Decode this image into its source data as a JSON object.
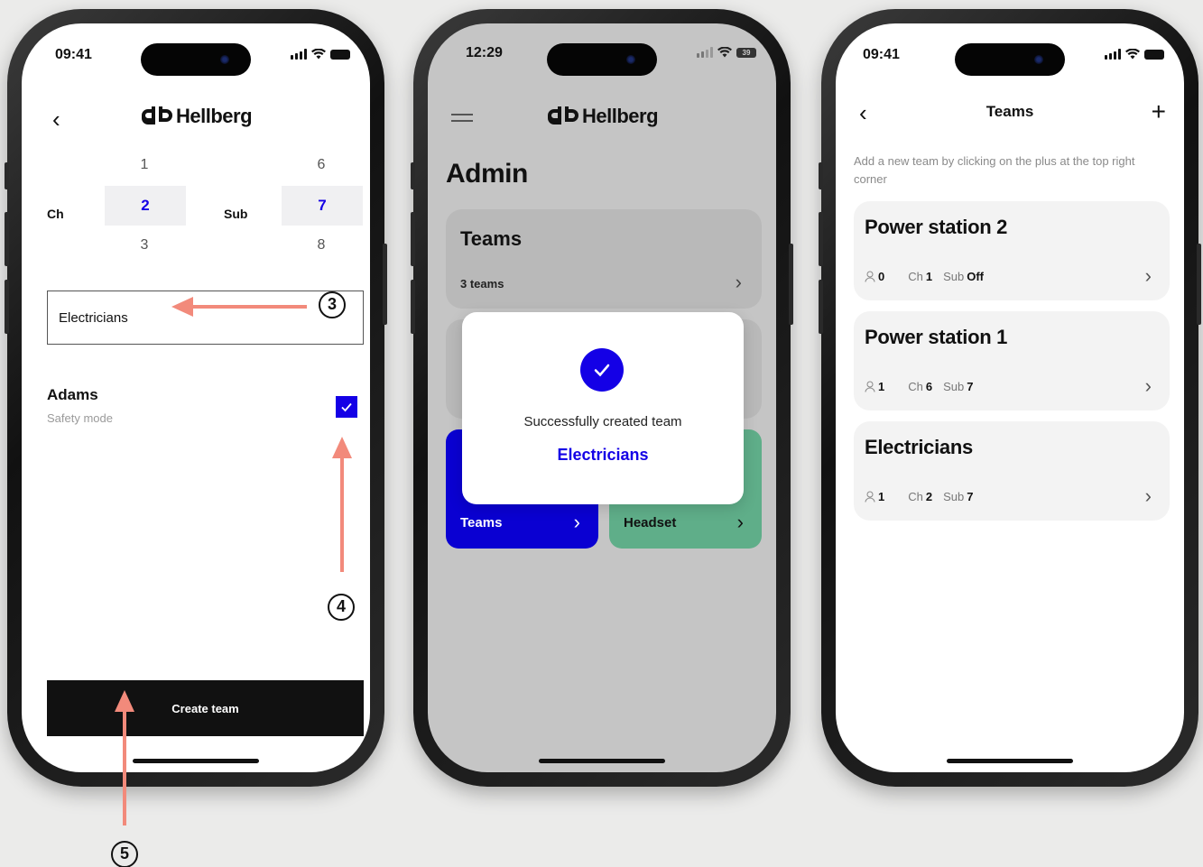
{
  "phone1": {
    "time": "09:41",
    "brand": "Hellberg",
    "picker": {
      "ch_label": "Ch",
      "sub_label": "Sub",
      "ch_above": "1",
      "ch_selected": "2",
      "ch_below": "3",
      "sub_above": "6",
      "sub_selected": "7",
      "sub_below": "8"
    },
    "team_name_value": "Electricians",
    "member": {
      "name": "Adams",
      "mode": "Safety mode",
      "checked": true
    },
    "create_button": "Create team"
  },
  "phone2": {
    "time": "12:29",
    "battery": "39",
    "brand": "Hellberg",
    "title": "Admin",
    "teams_card": {
      "title": "Teams",
      "subtitle": "3 teams"
    },
    "tile_teams": "Teams",
    "tile_headset": "Headset",
    "modal": {
      "message": "Successfully created team",
      "team": "Electricians"
    },
    "colors": {
      "tile_teams": "#0a00d2",
      "tile_headset": "#5fae89"
    }
  },
  "phone3": {
    "time": "09:41",
    "title": "Teams",
    "hint": "Add a new team by clicking on the plus at the top right corner",
    "teams": [
      {
        "name": "Power station 2",
        "members": "0",
        "ch_label": "Ch",
        "ch": "1",
        "sub_label": "Sub",
        "sub": "Off"
      },
      {
        "name": "Power station 1",
        "members": "1",
        "ch_label": "Ch",
        "ch": "6",
        "sub_label": "Sub",
        "sub": "7"
      },
      {
        "name": "Electricians",
        "members": "1",
        "ch_label": "Ch",
        "ch": "2",
        "sub_label": "Sub",
        "sub": "7"
      }
    ]
  },
  "annotations": {
    "step3": "3",
    "step4": "4",
    "step5": "5",
    "color": "#f28a7b"
  }
}
